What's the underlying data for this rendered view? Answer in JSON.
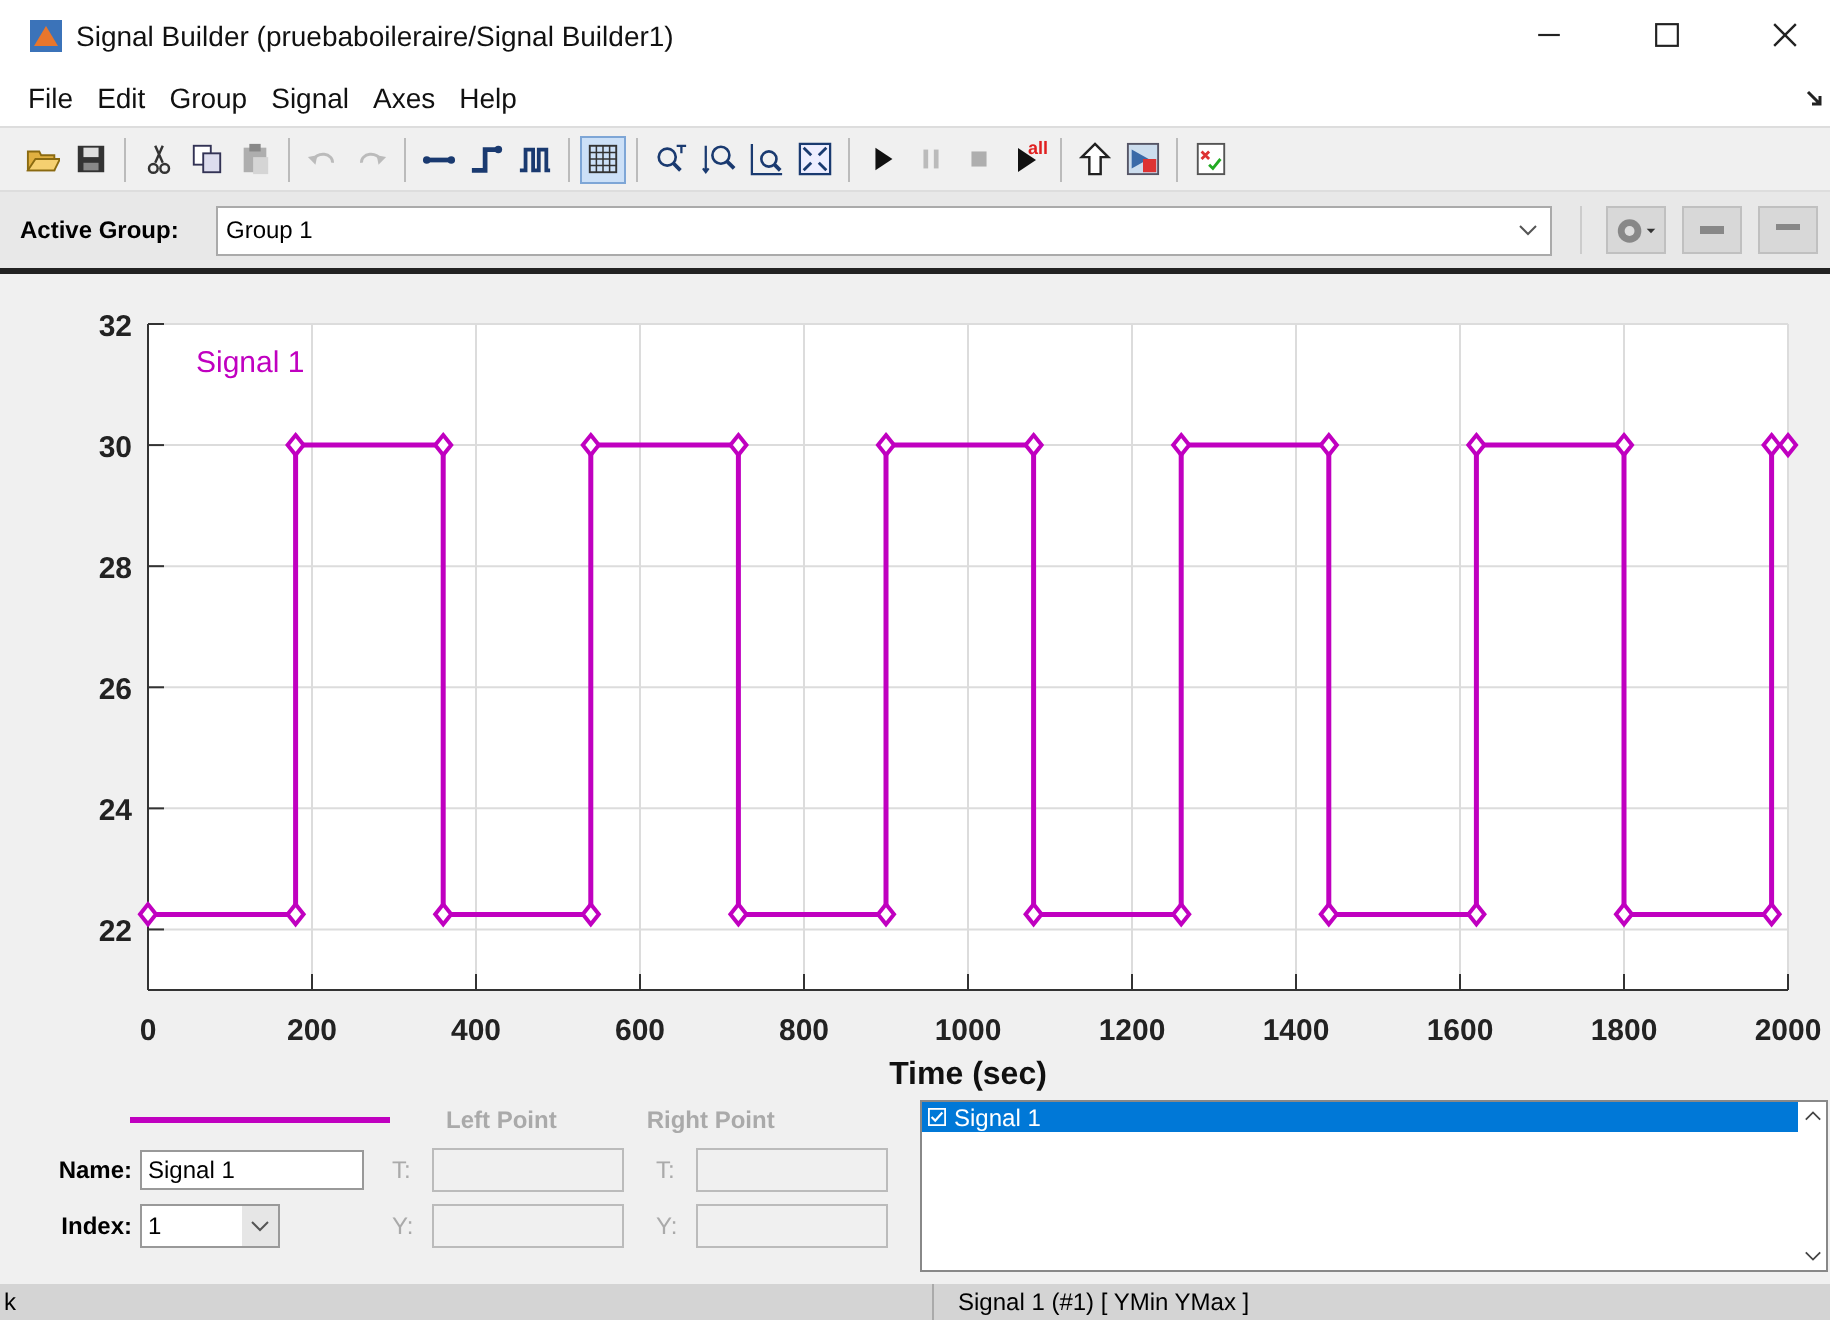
{
  "window": {
    "title": "Signal Builder (pruebaboileraire/Signal Builder1)"
  },
  "menu": [
    "File",
    "Edit",
    "Group",
    "Signal",
    "Axes",
    "Help"
  ],
  "toolbar": [
    [
      {
        "kind": "open",
        "disabled": false,
        "pressed": false
      },
      {
        "kind": "save",
        "disabled": false,
        "pressed": false
      }
    ],
    [
      {
        "kind": "cut",
        "disabled": false,
        "pressed": false
      },
      {
        "kind": "copy",
        "disabled": false,
        "pressed": false
      },
      {
        "kind": "paste",
        "disabled": true,
        "pressed": false
      }
    ],
    [
      {
        "kind": "undo",
        "disabled": true,
        "pressed": false
      },
      {
        "kind": "redo",
        "disabled": true,
        "pressed": false
      }
    ],
    [
      {
        "kind": "line",
        "disabled": false,
        "pressed": false
      },
      {
        "kind": "step",
        "disabled": false,
        "pressed": false
      },
      {
        "kind": "pulse",
        "disabled": false,
        "pressed": false
      }
    ],
    [
      {
        "kind": "grid",
        "disabled": false,
        "pressed": true
      }
    ],
    [
      {
        "kind": "zoomx",
        "disabled": false,
        "pressed": false
      },
      {
        "kind": "zoomy",
        "disabled": false,
        "pressed": false
      },
      {
        "kind": "zoombox",
        "disabled": false,
        "pressed": false
      },
      {
        "kind": "fit",
        "disabled": false,
        "pressed": false
      }
    ],
    [
      {
        "kind": "play",
        "disabled": false,
        "pressed": false
      },
      {
        "kind": "pause",
        "disabled": true,
        "pressed": false
      },
      {
        "kind": "stop",
        "disabled": true,
        "pressed": false
      },
      {
        "kind": "runall",
        "disabled": false,
        "pressed": false,
        "label": "all"
      }
    ],
    [
      {
        "kind": "up",
        "disabled": false,
        "pressed": false
      },
      {
        "kind": "export",
        "disabled": false,
        "pressed": false
      }
    ],
    [
      {
        "kind": "check",
        "disabled": false,
        "pressed": false
      }
    ]
  ],
  "active_group": {
    "label": "Active Group:",
    "value": "Group 1"
  },
  "chart_data": {
    "type": "line",
    "xlabel": "Time (sec)",
    "x": [
      0,
      180,
      180,
      360,
      360,
      540,
      540,
      720,
      720,
      900,
      900,
      1080,
      1080,
      1260,
      1260,
      1440,
      1440,
      1620,
      1620,
      1800,
      1800,
      1980,
      1980,
      2000
    ],
    "series": [
      {
        "name": "Signal 1",
        "color": "#c000c0",
        "marker": "diamond",
        "values": [
          22.25,
          22.25,
          30,
          30,
          22.25,
          22.25,
          30,
          30,
          22.25,
          22.25,
          30,
          30,
          22.25,
          22.25,
          30,
          30,
          22.25,
          22.25,
          30,
          30,
          22.25,
          22.25,
          30,
          30
        ]
      }
    ],
    "xlim": [
      0,
      2000
    ],
    "ylim": [
      21,
      32
    ],
    "xticks": [
      0,
      200,
      400,
      600,
      800,
      1000,
      1200,
      1400,
      1600,
      1800,
      2000
    ],
    "yticks": [
      22,
      24,
      26,
      28,
      30,
      32
    ],
    "grid": true
  },
  "signal_panel": {
    "name_label": "Name:",
    "name_value": "Signal 1",
    "index_label": "Index:",
    "index_value": "1",
    "left_point": {
      "title": "Left Point",
      "t_label": "T:",
      "y_label": "Y:",
      "disabled": true
    },
    "right_point": {
      "title": "Right Point",
      "t_label": "T:",
      "y_label": "Y:",
      "disabled": true
    }
  },
  "signals": [
    {
      "label": "Signal 1",
      "checked": true,
      "selected": true
    }
  ],
  "status_bar": {
    "left": "k",
    "right": "Signal 1 (#1)  [ YMin YMax ]"
  }
}
